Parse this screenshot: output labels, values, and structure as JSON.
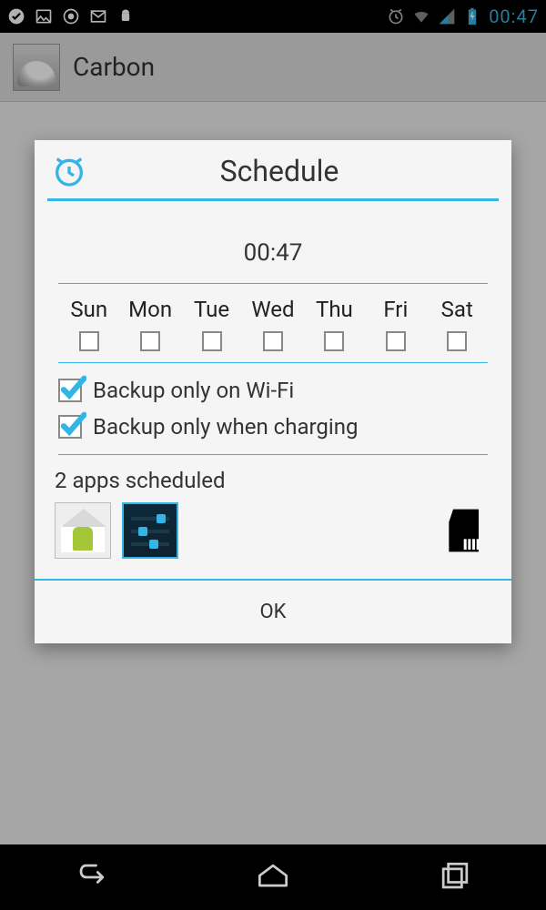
{
  "statusbar": {
    "clock": "00:47",
    "left_icons": [
      "check-circle-icon",
      "image-icon",
      "podcast-icon",
      "mail-icon",
      "android-icon"
    ],
    "right_icons": [
      "alarm-icon",
      "wifi-icon",
      "signal-icon",
      "battery-charging-icon"
    ]
  },
  "actionbar": {
    "app_name": "Carbon"
  },
  "dialog": {
    "title": "Schedule",
    "time": "00:47",
    "days": [
      {
        "label": "Sun",
        "checked": false
      },
      {
        "label": "Mon",
        "checked": false
      },
      {
        "label": "Tue",
        "checked": false
      },
      {
        "label": "Wed",
        "checked": false
      },
      {
        "label": "Thu",
        "checked": false
      },
      {
        "label": "Fri",
        "checked": false
      },
      {
        "label": "Sat",
        "checked": false
      }
    ],
    "options": {
      "wifi": {
        "label": "Backup only on Wi-Fi",
        "checked": true
      },
      "charging": {
        "label": "Backup only when charging",
        "checked": true
      }
    },
    "scheduled_summary": "2 apps scheduled",
    "scheduled_apps": [
      "launcher-app-icon",
      "settings-app-icon"
    ],
    "destination_icon": "sd-card-icon",
    "ok_label": "OK"
  },
  "colors": {
    "accent": "#33b5e5"
  }
}
